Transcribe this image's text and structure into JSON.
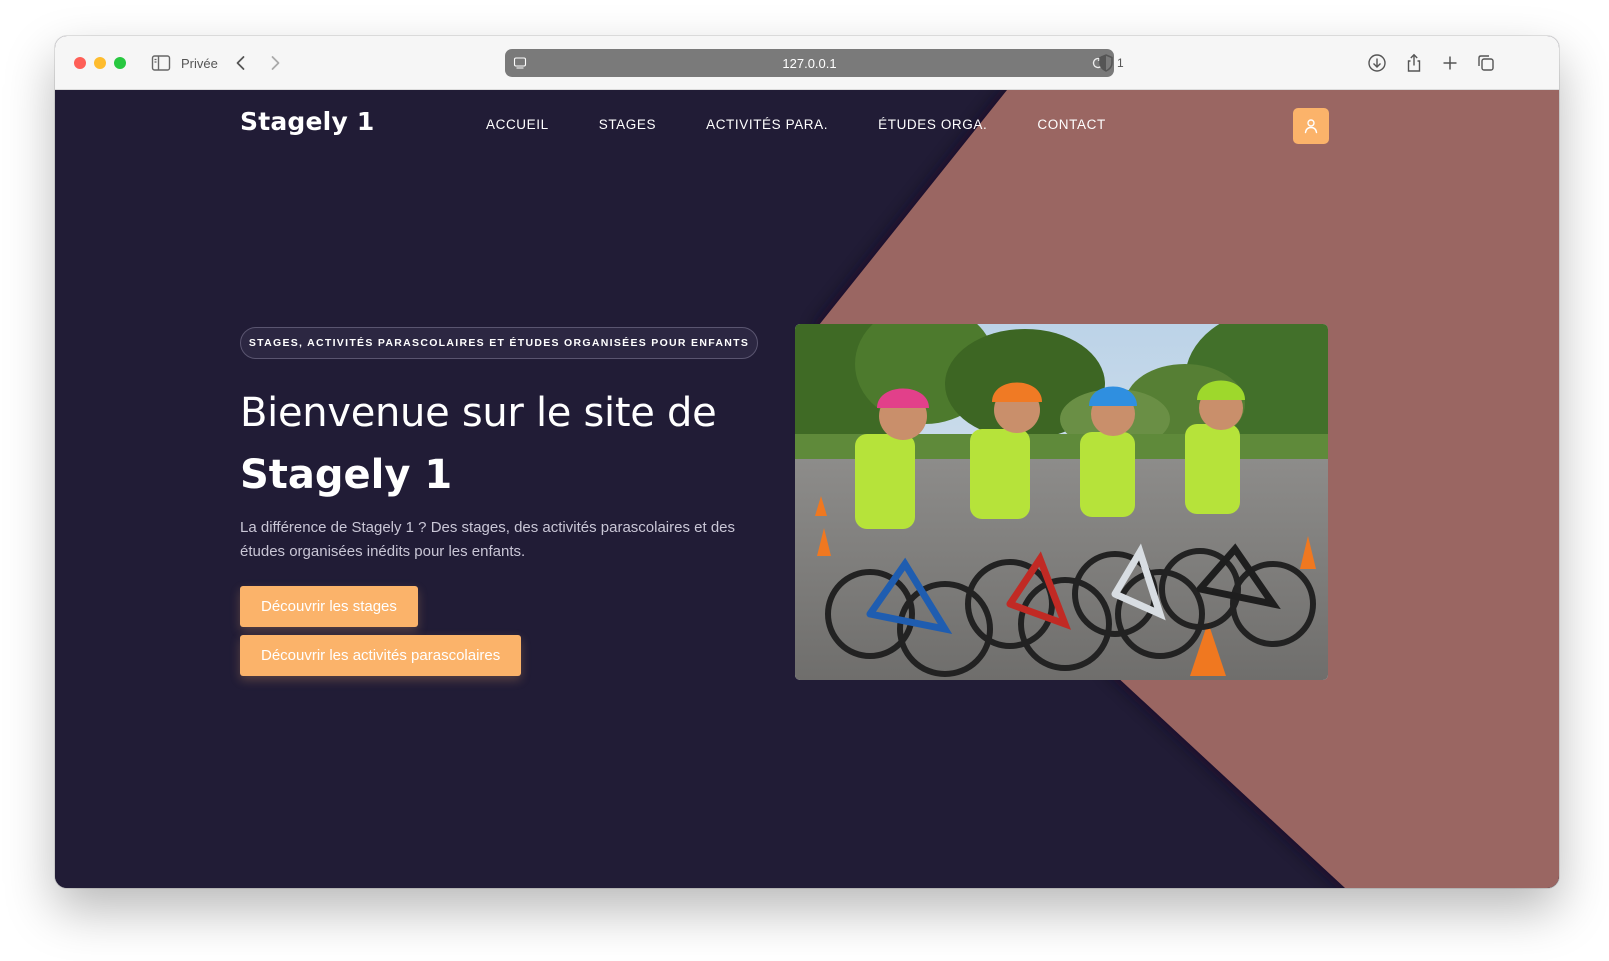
{
  "browser": {
    "mode_label": "Privée",
    "url": "127.0.0.1",
    "shield_count": "1"
  },
  "header": {
    "brand": "Stagely 1",
    "nav": [
      {
        "label": "ACCUEIL"
      },
      {
        "label": "STAGES"
      },
      {
        "label": "ACTIVITÉS PARA."
      },
      {
        "label": "ÉTUDES ORGA."
      },
      {
        "label": "CONTACT"
      }
    ],
    "user_icon": "user-icon"
  },
  "hero": {
    "badge": "STAGES, ACTIVITÉS PARASCOLAIRES ET ÉTUDES ORGANISÉES POUR ENFANTS",
    "title_line1": "Bienvenue sur le site de",
    "title_line2": "Stagely 1",
    "lead": "La différence de Stagely 1 ? Des stages, des activités parascolaires et des études organisées inédits pour les enfants.",
    "button_primary": "Découvrir les stages",
    "button_secondary": "Découvrir les activités parascolaires"
  },
  "colors": {
    "background": "#211c36",
    "accent_shape": "#9a6662",
    "button": "#fbb36a"
  }
}
